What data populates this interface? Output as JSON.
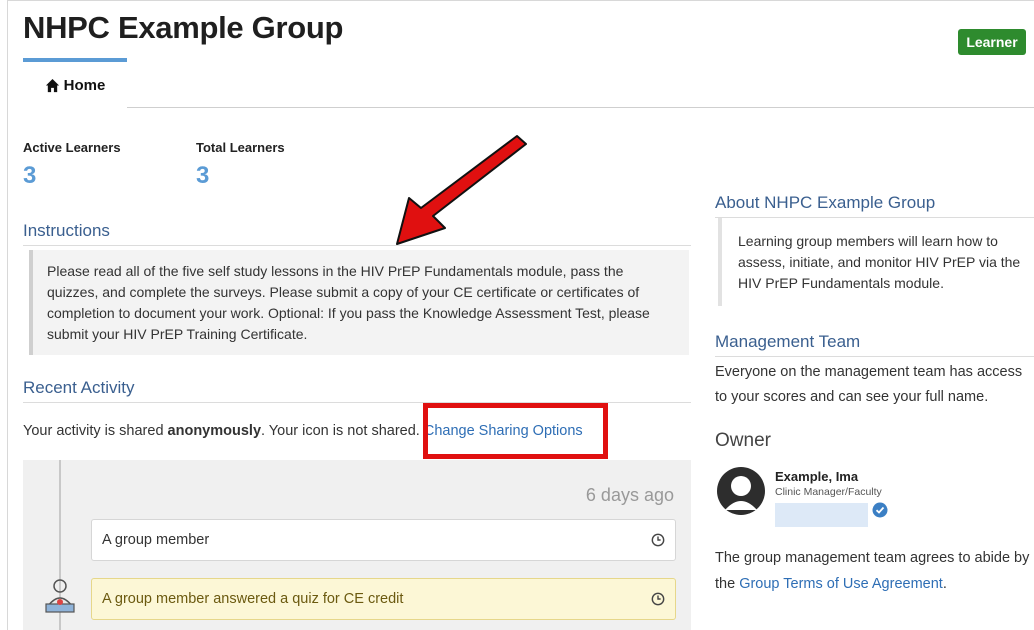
{
  "group": {
    "title": "NHPC Example Group",
    "role_badge": "Learner"
  },
  "tabs": {
    "home_label": "Home"
  },
  "stats": {
    "active_label": "Active Learners",
    "active_value": "3",
    "total_label": "Total Learners",
    "total_value": "3"
  },
  "instructions": {
    "heading": "Instructions",
    "body": "Please read all of the five self study lessons in the HIV PrEP Fundamentals module, pass the quizzes, and complete the surveys. Please submit a copy of your CE certificate or certificates of completion to document your work. Optional: If you pass the Knowledge Assessment Test, please submit your HIV PrEP Training Certificate."
  },
  "activity": {
    "heading": "Recent Activity",
    "prefix": "Your activity is shared ",
    "mode": "anonymously",
    "suffix": ". Your icon is not shared. ",
    "change_link": "Change Sharing Options",
    "time_ago": "6 days ago",
    "items": [
      {
        "text": "A group member"
      },
      {
        "text": "A group member answered a quiz for CE credit"
      }
    ]
  },
  "about": {
    "heading": "About NHPC Example Group",
    "body": "Learning group members will learn how to assess, initiate, and monitor HIV PrEP via the HIV PrEP Fundamentals module."
  },
  "management": {
    "heading": "Management Team",
    "body": "Everyone on the management team has access to your scores and can see your full name."
  },
  "owner": {
    "heading": "Owner",
    "name": "Example, Ima",
    "role": "Clinic Manager/Faculty"
  },
  "terms": {
    "prefix": "The group management team agrees to abide by the ",
    "link": "Group Terms of Use Agreement",
    "suffix": "."
  },
  "colors": {
    "accent": "#5b9bd5",
    "heading_blue": "#3a5f8f",
    "link": "#2e6eb5",
    "badge_green": "#2e8b2e",
    "annotation_red": "#e01010",
    "highlight_yellow": "#fcf7d6"
  },
  "icons": {
    "home": "home-icon",
    "clock": "clock-icon",
    "owner_avatar": "person-silhouette-icon",
    "verified": "verified-check-icon",
    "arrow": "red-arrow-annotation"
  }
}
